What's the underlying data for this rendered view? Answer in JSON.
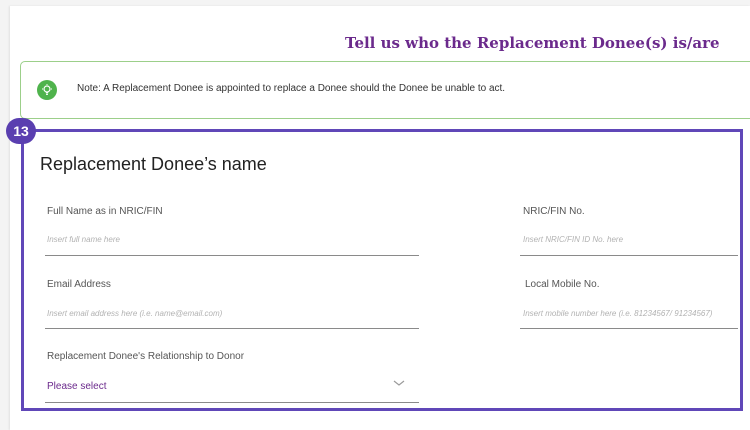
{
  "header": {
    "title": "Tell us who the Replacement Donee(s) is/are"
  },
  "note": {
    "icon": "lightbulb-icon",
    "text": "Note: A Replacement Donee is appointed to replace a Donee should the Donee be unable to act."
  },
  "badge": {
    "number": "13"
  },
  "section": {
    "title": "Replacement Donee’s name"
  },
  "fields": {
    "full_name": {
      "label": "Full Name as in NRIC/FIN",
      "placeholder": "Insert full name here"
    },
    "nric": {
      "label": "NRIC/FIN No.",
      "placeholder": "Insert NRIC/FIN ID No. here"
    },
    "email": {
      "label": "Email Address",
      "placeholder": "Insert email address here (i.e. name@email.com)"
    },
    "mobile": {
      "label": "Local Mobile No.",
      "placeholder": "Insert mobile number here (i.e. 81234567/ 91234567)"
    },
    "relationship": {
      "label": "Replacement Donee's Relationship to Donor",
      "selected": "Please select"
    }
  },
  "colors": {
    "accent_purple": "#6b2a8c",
    "highlight_frame": "#6047b8",
    "note_border": "#9ccf8a",
    "note_icon": "#4fb34c"
  }
}
